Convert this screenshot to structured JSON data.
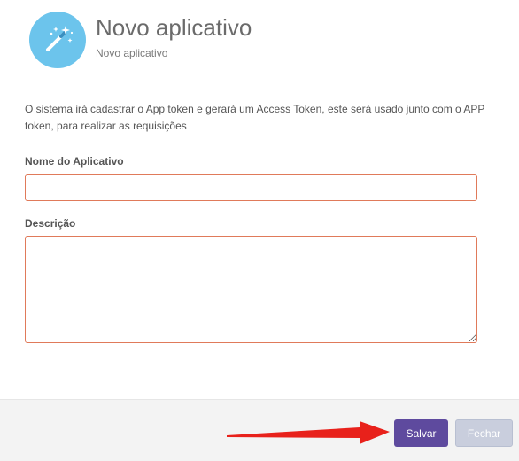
{
  "header": {
    "title": "Novo aplicativo",
    "subtitle": "Novo aplicativo",
    "icon": "magic-wand-icon",
    "icon_bg_color": "#6cc4ec"
  },
  "form": {
    "description": "O sistema irá cadastrar o App token e gerará um Access Token, este será usado junto com o APP token, para realizar as requisições",
    "name_label": "Nome do Aplicativo",
    "name_value": "",
    "desc_label": "Descrição",
    "desc_value": "",
    "field_border_color": "#e07a5a"
  },
  "footer": {
    "save_label": "Salvar",
    "close_label": "Fechar",
    "save_color": "#5e4a9e",
    "close_color": "#c9cedd"
  },
  "annotation": {
    "arrow_color": "#e8211b"
  }
}
